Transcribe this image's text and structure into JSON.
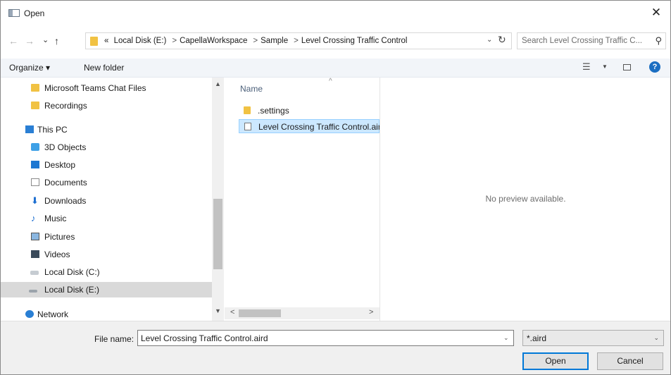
{
  "window": {
    "title": "Open",
    "close_glyph": "✕"
  },
  "nav": {
    "back": "←",
    "forward": "→",
    "recent": "⌄",
    "up": "↑",
    "overflow": "«",
    "breadcrumbs": [
      "Local Disk (E:)",
      "CapellaWorkspace",
      "Sample",
      "Level Crossing Traffic Control"
    ],
    "separator": ">",
    "dropdown": "⌄",
    "refresh": "↻"
  },
  "search": {
    "placeholder": "Search Level Crossing Traffic C...",
    "icon": "⚲"
  },
  "toolbar": {
    "organize_label": "Organize ▾",
    "new_folder_label": "New folder",
    "view_icon": "☰",
    "view_arrow": "▼",
    "help": "?"
  },
  "sidebar": {
    "items": [
      {
        "label": "Microsoft Teams Chat Files",
        "icon": "folder-icon"
      },
      {
        "label": "Recordings",
        "icon": "folder-icon"
      },
      {
        "label": "This PC",
        "icon": "pc-icon"
      },
      {
        "label": "3D Objects",
        "icon": "cube-icon"
      },
      {
        "label": "Desktop",
        "icon": "desktop-icon"
      },
      {
        "label": "Documents",
        "icon": "document-icon"
      },
      {
        "label": "Downloads",
        "icon": "download-icon"
      },
      {
        "label": "Music",
        "icon": "music-icon"
      },
      {
        "label": "Pictures",
        "icon": "picture-icon"
      },
      {
        "label": "Videos",
        "icon": "video-icon"
      },
      {
        "label": "Local Disk (C:)",
        "icon": "disk-icon"
      },
      {
        "label": "Local Disk (E:)",
        "icon": "disk-icon",
        "selected": true
      },
      {
        "label": "Network",
        "icon": "network-icon"
      }
    ],
    "scroll_up": "▲",
    "scroll_down": "▼"
  },
  "files": {
    "column_name": "Name",
    "sort_glyph": "^",
    "items": [
      {
        "label": ".settings",
        "icon": "folder-icon"
      },
      {
        "label": "Level Crossing Traffic Control.aird",
        "icon": "file-icon",
        "selected": true
      }
    ],
    "scroll_left": "<",
    "scroll_right": ">"
  },
  "preview": {
    "text": "No preview available."
  },
  "bottom": {
    "file_name_label": "File name:",
    "file_name_value": "Level Crossing Traffic Control.aird",
    "file_name_arrow": "⌄",
    "filter_value": "*.aird",
    "filter_arrow": "⌄",
    "open_label": "Open",
    "cancel_label": "Cancel"
  },
  "colors": {
    "accent": "#0078d7",
    "selection": "#cce8ff",
    "folder": "#f1c243"
  }
}
